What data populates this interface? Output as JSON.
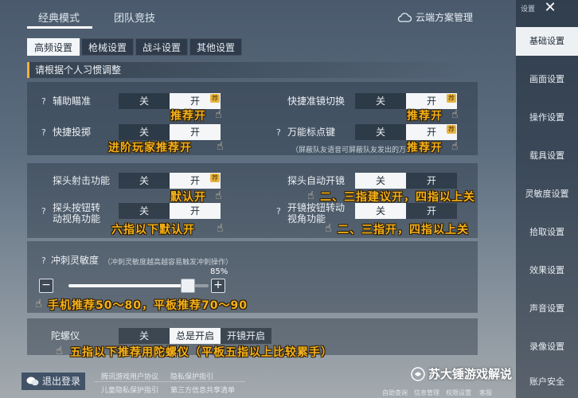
{
  "header": {
    "tabs": [
      "经典模式",
      "团队竞技"
    ],
    "cloud_label": "云端方案管理"
  },
  "subtabs": [
    "高频设置",
    "枪械设置",
    "战斗设置",
    "其他设置"
  ],
  "hint": "请根据个人习惯调整",
  "toggle_labels": {
    "off": "关",
    "on": "开",
    "badge": "荐"
  },
  "settings": {
    "assist_aim": "辅助瞄准",
    "quick_scope_switch": "快捷准镜切换",
    "quick_throw": "快捷投掷",
    "universal_mark": "万能标点键",
    "mark_note": "（屏蔽队友语音可屏蔽队友发出的万能",
    "peek_fire": "探头射击功能",
    "peek_auto_scope": "探头自动开镜",
    "peek_button_view": "探头按钮转动视角功能",
    "scope_button_view": "开镜按钮转动视角功能",
    "sprint_sensitivity": "冲刺灵敏度",
    "sprint_note": "（冲刺灵敏度越高越容易触发冲刺操作）",
    "slider_value_text": "85%",
    "slider_value": 85,
    "gyro": "陀螺仪",
    "gyro_options": [
      "关",
      "总是开启",
      "开镜开启"
    ]
  },
  "annotations": {
    "a1": "推荐开",
    "a2": "推荐开",
    "a3": "进阶玩家推荐开",
    "a4": "推荐开",
    "a5": "默认开",
    "a6": "二、三指建议开，四指以上关",
    "a7": "六指以下默认开",
    "a8": "二、三指开，四指以上关",
    "a9": "手机推荐50～80，平板推荐70～90",
    "a10": "五指以下推荐用陀螺仪（平板五指以上比较累手）"
  },
  "bottom": {
    "logout": "退出登录",
    "links": [
      "腾讯游戏用户协议",
      "隐私保护指引",
      "儿童隐私保护指引",
      "第三方信息共享清单"
    ],
    "strip": [
      "自助查询",
      "信息管理",
      "权限设置",
      "客服"
    ]
  },
  "sidebar": {
    "top_label": "设置",
    "items": [
      "基础设置",
      "画面设置",
      "操作设置",
      "载具设置",
      "灵敏度设置",
      "拾取设置",
      "效果设置",
      "声音设置",
      "录像设置",
      "账户安全"
    ]
  },
  "watermark": "苏大锤游戏解说",
  "colors": {
    "annotation": "#f6b21b",
    "accent_bar": "#f0b13b",
    "badge": "#e7b541"
  }
}
